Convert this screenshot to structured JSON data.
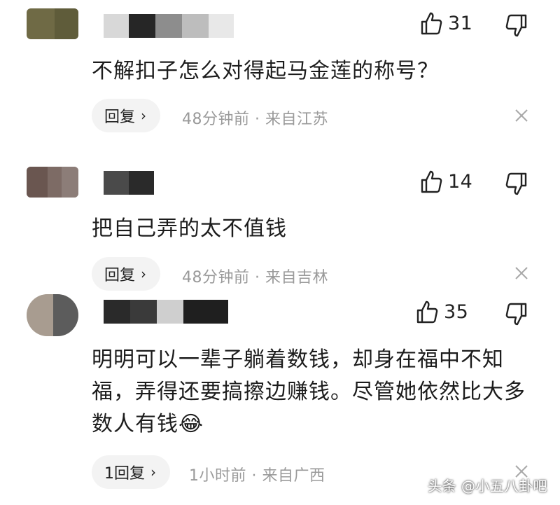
{
  "comments": [
    {
      "likes": "31",
      "text": "不解扣子怎么对得起马金莲的称号？",
      "reply_label": "回复",
      "reply_chevron": "›",
      "meta": "48分钟前 · 来自江苏"
    },
    {
      "likes": "14",
      "text": "把自己弄的太不值钱",
      "reply_label": "回复",
      "reply_chevron": "›",
      "meta": "48分钟前 · 来自吉林"
    },
    {
      "likes": "35",
      "text": "明明可以一辈子躺着数钱，却身在福中不知福，弄得还要搞擦边赚钱。尽管她依然比大多数人有钱",
      "emoji": "😂",
      "reply_label": "1回复",
      "reply_chevron": "›",
      "meta": "1小时前 · 来自广西"
    }
  ],
  "icons": {
    "like": "thumbs-up-icon",
    "dislike": "thumbs-down-icon",
    "close": "close-icon"
  },
  "watermark": "头条 @小五八卦吧"
}
